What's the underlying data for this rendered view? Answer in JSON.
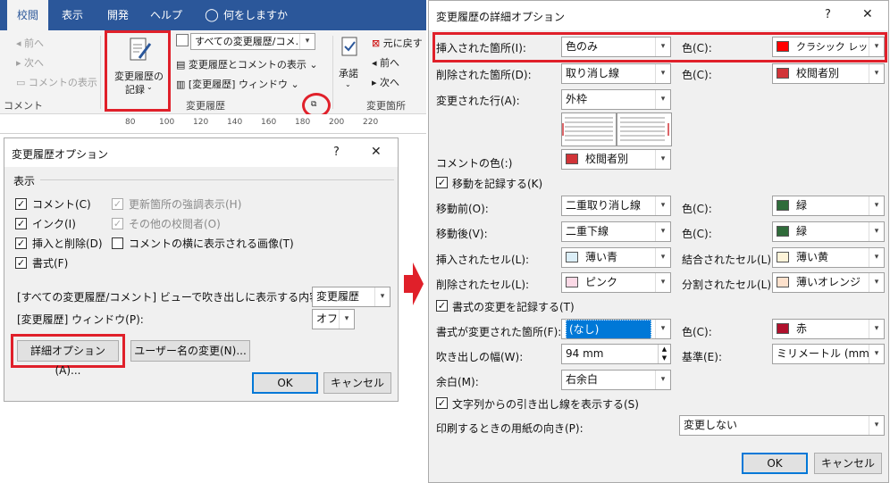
{
  "ribbon": {
    "tabs": [
      "校閲",
      "表示",
      "開発",
      "ヘルプ",
      "何をしますか"
    ],
    "comment_group": {
      "prev": "前へ",
      "next": "次へ",
      "show": "コメントの表示",
      "label": "コメント"
    },
    "track": {
      "big_line1": "変更履歴の",
      "big_line2": "記録",
      "all_markup": "すべての変更履歴/コメ…",
      "show_markup": "変更履歴とコメントの表示",
      "pane": "[変更履歴] ウィンドウ",
      "label": "変更履歴"
    },
    "changes": {
      "accept": "承諾",
      "undo": "元に戻す",
      "prev": "前へ",
      "next": "次へ",
      "label": "変更箇所"
    },
    "ruler": [
      "80",
      "100",
      "120",
      "140",
      "160",
      "180",
      "200",
      "220"
    ]
  },
  "dialog1": {
    "title": "変更履歴オプション",
    "help": "?",
    "close": "✕",
    "section": "表示",
    "checks": [
      {
        "label": "コメント(C)",
        "checked": true
      },
      {
        "label": "インク(I)",
        "checked": true
      },
      {
        "label": "挿入と削除(D)",
        "checked": true
      },
      {
        "label": "書式(F)",
        "checked": true
      },
      {
        "label": "更新箇所の強調表示(H)",
        "checked": true
      },
      {
        "label": "その他の校閲者(O)",
        "checked": true
      },
      {
        "label": "コメントの横に表示される画像(T)",
        "checked": false
      }
    ],
    "balloon_label": "[すべての変更履歴/コメント] ビューで吹き出しに表示する内容 (B):",
    "balloon_value": "変更履歴",
    "pane_label": "[変更履歴] ウィンドウ(P):",
    "pane_value": "オフ",
    "advanced": "詳細オプション(A)...",
    "username": "ユーザー名の変更(N)...",
    "ok": "OK",
    "cancel": "キャンセル"
  },
  "dialog2": {
    "title": "変更履歴の詳細オプション",
    "help": "?",
    "close": "✕",
    "color_label": "色(C):",
    "rows": {
      "insert": {
        "label": "挿入された箇所(I):",
        "value": "色のみ",
        "color": "クラシック レッド",
        "swatch": "#ff0000"
      },
      "delete": {
        "label": "削除された箇所(D):",
        "value": "取り消し線",
        "color": "校閲者別",
        "swatch": "#d13438"
      },
      "changed_line": {
        "label": "変更された行(A):",
        "value": "外枠"
      },
      "comment_color": {
        "label": "コメントの色(:)",
        "value": "校閲者別",
        "swatch": "#d13438"
      },
      "track_moves": "移動を記録する(K)",
      "move_from": {
        "label": "移動前(O):",
        "value": "二重取り消し線",
        "color": "緑",
        "swatch": "#2f6b3a"
      },
      "move_to": {
        "label": "移動後(V):",
        "value": "二重下線",
        "color": "緑",
        "swatch": "#2f6b3a"
      },
      "inserted_cells": {
        "label": "挿入されたセル(L):",
        "value": "薄い青",
        "swatch": "#dbeef7"
      },
      "merged_cells": {
        "label": "結合されたセル(L):",
        "value": "薄い黄",
        "swatch": "#fdf3d8"
      },
      "deleted_cells": {
        "label": "削除されたセル(L):",
        "value": "ピンク",
        "swatch": "#fbd9e6"
      },
      "split_cells": {
        "label": "分割されたセル(L):",
        "value": "薄いオレンジ",
        "swatch": "#fde1cc"
      },
      "track_format": "書式の変更を記録する(T)",
      "format": {
        "label": "書式が変更された箇所(F):",
        "value": "(なし)",
        "color": "赤",
        "swatch": "#b0102c"
      },
      "balloon_width": {
        "label": "吹き出しの幅(W):",
        "value": "94 mm"
      },
      "measure": {
        "label": "基準(E):",
        "value": "ミリメートル (mm)"
      },
      "margin": {
        "label": "余白(M):",
        "value": "右余白"
      },
      "show_lines": "文字列からの引き出し線を表示する(S)",
      "orientation": {
        "label": "印刷するときの用紙の向き(P):",
        "value": "変更しない"
      }
    },
    "ok": "OK",
    "cancel": "キャンセル"
  }
}
